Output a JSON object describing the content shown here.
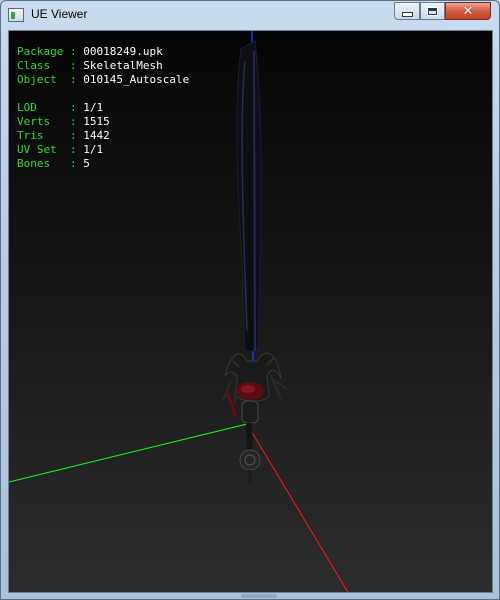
{
  "window": {
    "title": "UE Viewer",
    "controls": {
      "minimize": "minimize",
      "maximize": "maximize",
      "close": "close"
    }
  },
  "info": {
    "package": {
      "label": "Package",
      "value": "00018249.upk"
    },
    "class": {
      "label": "Class  ",
      "value": "SkeletalMesh"
    },
    "object": {
      "label": "Object ",
      "value": "010145_Autoscale"
    },
    "lod": {
      "label": "LOD    ",
      "value": "1/1"
    },
    "verts": {
      "label": "Verts  ",
      "value": "1515"
    },
    "tris": {
      "label": "Tris   ",
      "value": "1442"
    },
    "uvset": {
      "label": "UV Set ",
      "value": "1/1"
    },
    "bones": {
      "label": "Bones  ",
      "value": "5"
    },
    "separator": " : "
  },
  "colors": {
    "label_green": "#2fdc2f",
    "value_white": "#ffffff",
    "axis_x": "#ff1a1a",
    "axis_y": "#1aff1a",
    "axis_z": "#2233ff"
  },
  "icons": {
    "app": "app-icon",
    "min": "minimize-icon",
    "max": "maximize-icon",
    "close": "close-icon"
  }
}
